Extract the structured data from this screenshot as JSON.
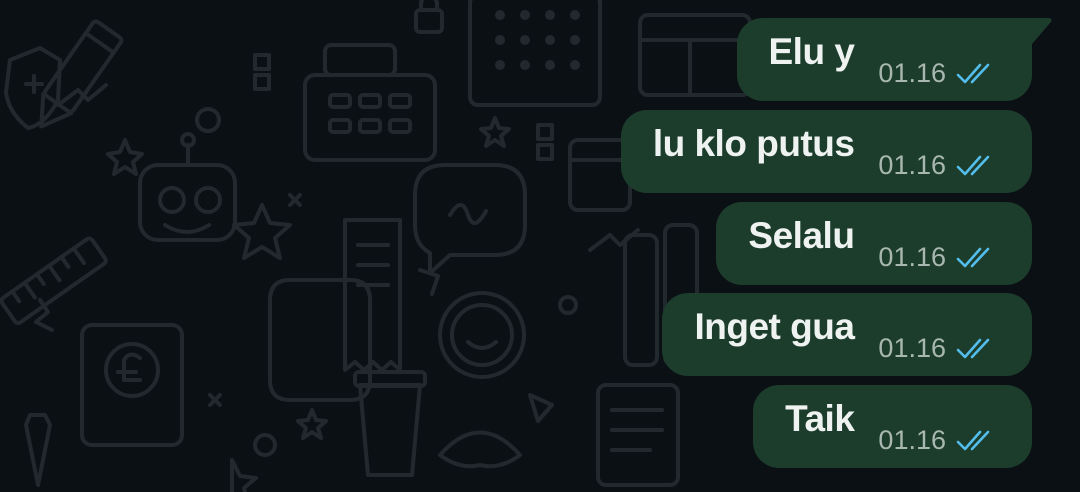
{
  "chat": {
    "messages": [
      {
        "text": "Elu y",
        "time": "01.16",
        "status": "read"
      },
      {
        "text": "lu klo putus",
        "time": "01.16",
        "status": "read"
      },
      {
        "text": "Selalu",
        "time": "01.16",
        "status": "read"
      },
      {
        "text": "Inget gua",
        "time": "01.16",
        "status": "read"
      },
      {
        "text": "Taik",
        "time": "01.16",
        "status": "read"
      }
    ]
  },
  "colors": {
    "background": "#0b1014",
    "outgoing_bubble": "#1d3d2c",
    "read_ticks": "#53bdeb",
    "doodle": "#1e2428"
  },
  "icons": [
    "double-check-icon"
  ]
}
